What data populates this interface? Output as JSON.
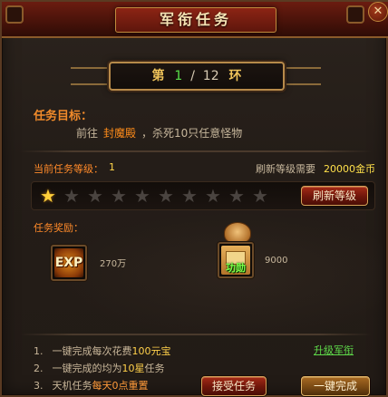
{
  "window": {
    "title": "军衔任务",
    "close_glyph": "✕"
  },
  "ring": {
    "word_di": "第",
    "current": "1",
    "separator": "/",
    "total": "12",
    "word_huan": "环"
  },
  "objective": {
    "label": "任务目标：",
    "prefix": "前往",
    "place": "封魔殿",
    "suffix": "，杀死10只任意怪物"
  },
  "level": {
    "label": "当前任务等级：",
    "value": "1",
    "stars_filled": 1,
    "stars_total": 10,
    "refresh_need_label": "刷新等级需要",
    "refresh_need_value": "20000金币",
    "refresh_button": "刷新等级"
  },
  "rewards": {
    "label": "任务奖励：",
    "items": [
      {
        "name": "exp-icon",
        "icon_text": "EXP",
        "value": "270万"
      },
      {
        "name": "merit-icon",
        "icon_text": "功勋",
        "value": "9000"
      }
    ]
  },
  "notes": [
    {
      "num": "1.",
      "pre": "一键完成每次花费",
      "hl": "100元宝",
      "post": ""
    },
    {
      "num": "2.",
      "pre": "一键完成的均为",
      "hl": "10星",
      "post": "任务"
    },
    {
      "num": "3.",
      "pre": "天机任务",
      "hl": "每天0点重置",
      "post": ""
    }
  ],
  "links": {
    "upgrade": "升级军衔"
  },
  "buttons": {
    "accept": "接受任务",
    "one_click": "一键完成"
  },
  "colors": {
    "title_red": "#6b1c10",
    "accent_orange": "#f08a2a",
    "gold": "#ffd04a",
    "green": "#58e04a"
  }
}
